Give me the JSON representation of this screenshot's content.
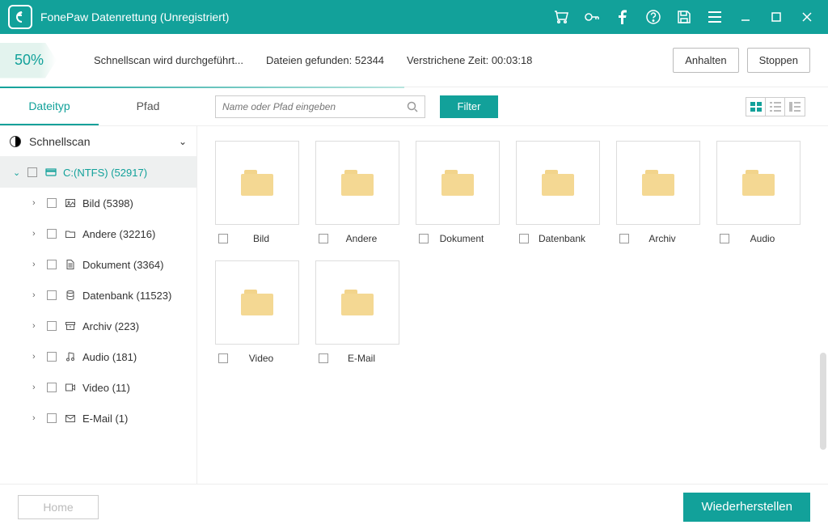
{
  "titlebar": {
    "title": "FonePaw Datenrettung (Unregistriert)"
  },
  "progress": {
    "percent": "50%",
    "status_text": "Schnellscan wird durchgeführt...",
    "files_found_label": "Dateien gefunden:",
    "files_found_count": "52344",
    "elapsed_label": "Verstrichene Zeit:",
    "elapsed_time": "00:03:18",
    "pause_label": "Anhalten",
    "stop_label": "Stoppen"
  },
  "sidebar": {
    "tab_type": "Dateityp",
    "tab_path": "Pfad",
    "scan_header": "Schnellscan",
    "drive": "C:(NTFS) (52917)",
    "items": [
      {
        "label": "Bild (5398)"
      },
      {
        "label": "Andere (32216)"
      },
      {
        "label": "Dokument (3364)"
      },
      {
        "label": "Datenbank (11523)"
      },
      {
        "label": "Archiv (223)"
      },
      {
        "label": "Audio (181)"
      },
      {
        "label": "Video (11)"
      },
      {
        "label": "E-Mail (1)"
      }
    ]
  },
  "toolbar": {
    "search_placeholder": "Name oder Pfad eingeben",
    "filter_label": "Filter"
  },
  "folders": [
    {
      "name": "Bild"
    },
    {
      "name": "Andere"
    },
    {
      "name": "Dokument"
    },
    {
      "name": "Datenbank"
    },
    {
      "name": "Archiv"
    },
    {
      "name": "Audio"
    },
    {
      "name": "Video"
    },
    {
      "name": "E-Mail"
    }
  ],
  "footer": {
    "home_label": "Home",
    "recover_label": "Wiederherstellen"
  },
  "colors": {
    "accent": "#12a19a"
  }
}
